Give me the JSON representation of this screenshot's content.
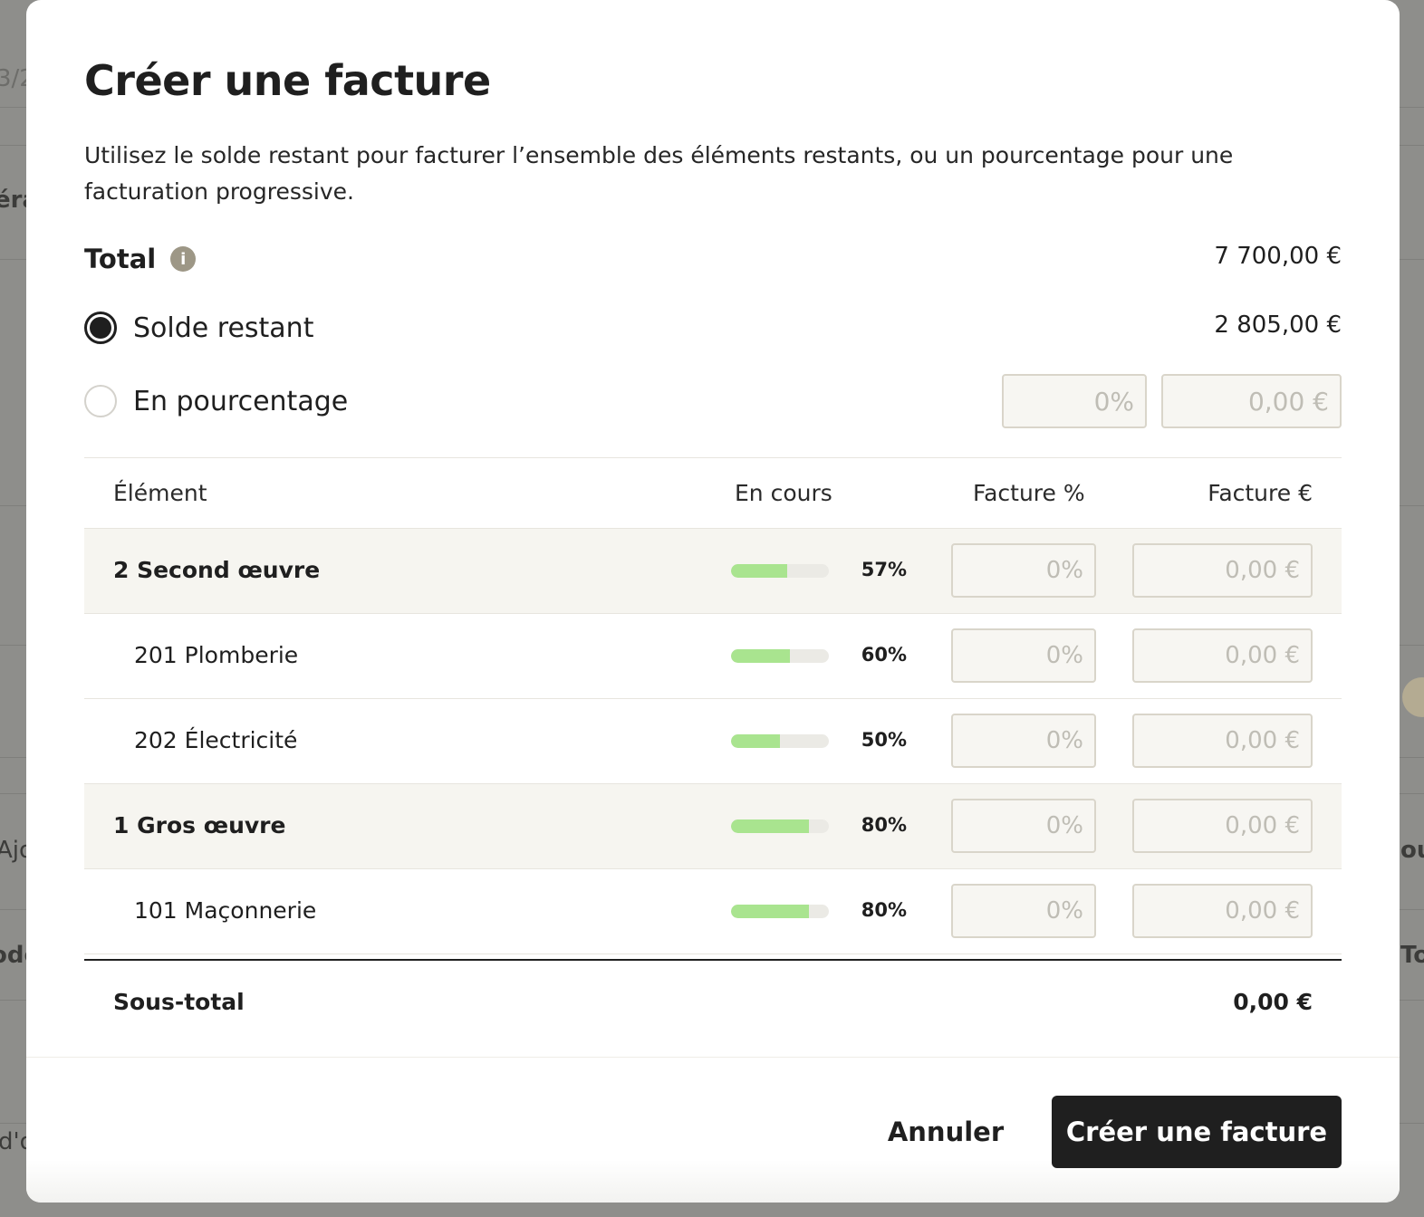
{
  "background": {
    "fragments": [
      "3/2",
      "éra",
      "Ajo",
      "ode",
      "d'o",
      "ou",
      "Tot"
    ]
  },
  "modal": {
    "title": "Créer une facture",
    "description": "Utilisez le solde restant pour facturer l’ensemble des éléments restants, ou un pourcentage pour une facturation progressive.",
    "total": {
      "label": "Total",
      "icon": "info-icon",
      "value": "7 700,00 €"
    },
    "options": {
      "remaining": {
        "label": "Solde restant",
        "value": "2 805,00 €",
        "selected": true
      },
      "percentage": {
        "label": "En pourcentage",
        "percent_placeholder": "0%",
        "amount_placeholder": "0,00 €",
        "selected": false
      }
    },
    "table": {
      "headers": {
        "element": "Élément",
        "progress": "En cours",
        "invoice_pct": "Facture %",
        "invoice_eur": "Facture €"
      },
      "rows": [
        {
          "name": "2 Second œuvre",
          "progress_label": "57%",
          "progress": 57,
          "pct_placeholder": "0%",
          "eur_placeholder": "0,00 €"
        },
        {
          "name": "201 Plomberie",
          "progress_label": "60%",
          "progress": 60,
          "pct_placeholder": "0%",
          "eur_placeholder": "0,00 €"
        },
        {
          "name": "202 Électricité",
          "progress_label": "50%",
          "progress": 50,
          "pct_placeholder": "0%",
          "eur_placeholder": "0,00 €"
        },
        {
          "name": "1 Gros œuvre",
          "progress_label": "80%",
          "progress": 80,
          "pct_placeholder": "0%",
          "eur_placeholder": "0,00 €"
        },
        {
          "name": "101 Maçonnerie",
          "progress_label": "80%",
          "progress": 80,
          "pct_placeholder": "0%",
          "eur_placeholder": "0,00 €"
        }
      ],
      "subtotal": {
        "label": "Sous-total",
        "value": "0,00 €"
      }
    },
    "footer": {
      "cancel_label": "Annuler",
      "submit_label": "Créer une facture"
    }
  },
  "colors": {
    "accent": "#1f1f1f",
    "progress_fill": "#a9e48f",
    "progress_track": "#ebeae5",
    "group_row_bg": "#f6f5f0"
  }
}
